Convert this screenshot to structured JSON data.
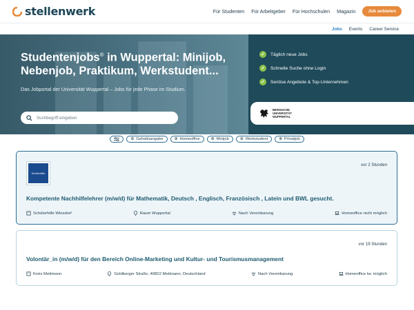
{
  "header": {
    "logo_text": "stellenwerk",
    "nav": [
      "Für Studenten",
      "Für Arbeitgeber",
      "Für Hochschulen",
      "Magazin"
    ],
    "cta_label": "Job anbieten"
  },
  "subnav": [
    "Jobs",
    "Events",
    "Career Service"
  ],
  "hero": {
    "title_prefix": "Studentenjobs",
    "title_mark": "®",
    "title_rest": " in Wuppertal: Minijob, Nebenjob, Praktikum, Werkstudent...",
    "subtitle": "Das Jobportal der Universität Wuppertal – Jobs für jede Phase im Studium.",
    "search_placeholder": "Suchbegriff eingeben",
    "features": [
      "Täglich neue Jobs",
      "Schnelle Suche ohne Login",
      "Seriöse Angebote & Top-Unternehmen"
    ],
    "university_lines": [
      "Bergische",
      "Universität",
      "Wuppertal"
    ]
  },
  "filters": [
    "Gehaltsangabe",
    "Homeoffice",
    "Minijob",
    "Werkstudent",
    "Privatjob"
  ],
  "jobs": [
    {
      "time": "vor 2 Stunden",
      "logo_text": "Schülerhilfe!",
      "title": "Kompetente Nachhilfelehrer (m/w/d) für Mathematik, Deutsch , Englisch, Französisch , Latein und BWL gesucht.",
      "company": "Schülerhilfe Wiesdorf",
      "location": "Raum Wuppertal",
      "salary": "Nach Vereinbarung",
      "homeoffice": "Homeoffice nicht möglich"
    },
    {
      "time": "vor 19 Stunden",
      "title": "Volontär_in (m/w/d) für den Bereich Online-Marketing und Kultur- und Tourismusmanagement",
      "company": "Kreis Mettmann",
      "location": "Goldberger Straße, 40822 Mettmann, Deutschland",
      "salary": "Nach Vereinbarung",
      "homeoffice": "Homeoffice tw. möglich"
    }
  ],
  "colors": {
    "accent_orange": "#e78a3b",
    "brand_dark": "#1d4657",
    "link_blue": "#2a7fbf",
    "check_green": "#8bc34a"
  }
}
